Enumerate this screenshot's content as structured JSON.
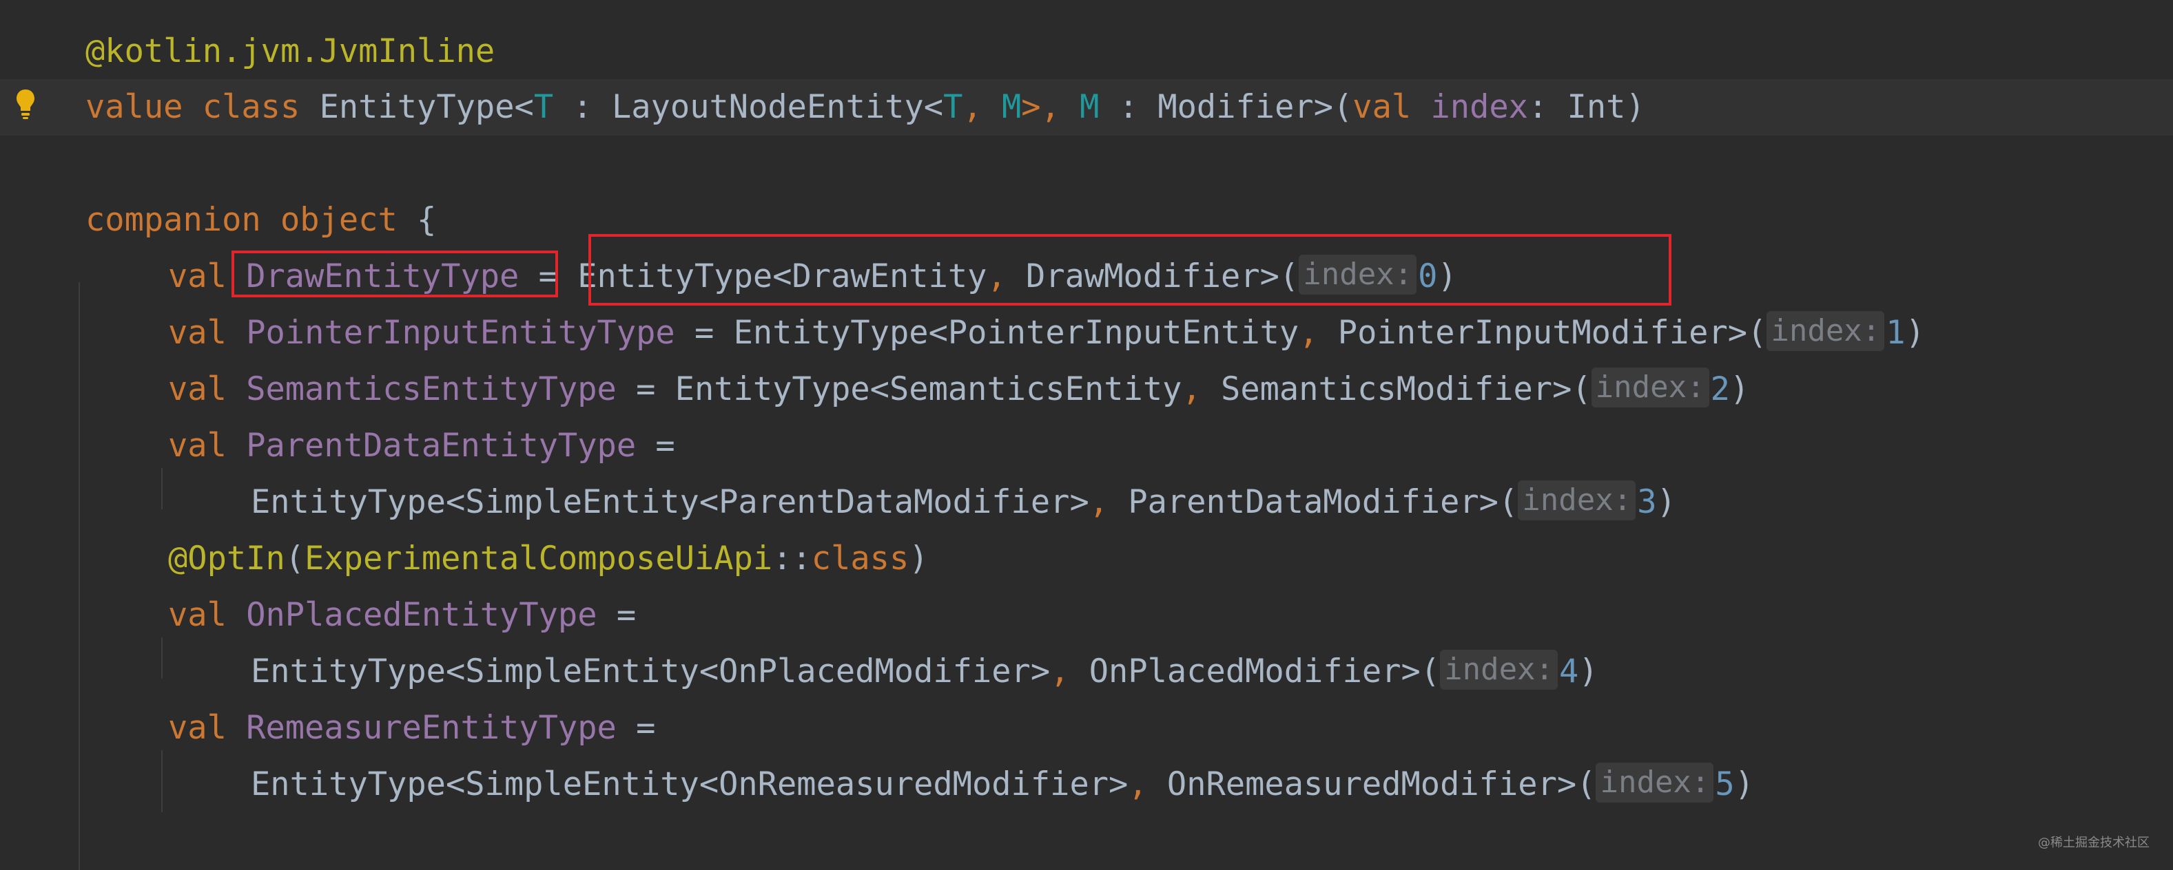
{
  "editor": {
    "lines": {
      "l1": {
        "annotation": "@kotlin.jvm.JvmInline"
      },
      "l2": {
        "kw_value": "value",
        "kw_class": "class",
        "class_name": "EntityType",
        "lt1": "<",
        "T1": "T",
        "colon1": " : ",
        "bound": "LayoutNodeEntity",
        "lt2": "<",
        "T2": "T",
        "comma1": ",",
        "M1": " M",
        "gt_comma": ">,",
        "M2": " M",
        "colon2": " : ",
        "modifier": "Modifier",
        "gt_paren": ">(",
        "kw_val": "val",
        "param": "index",
        "param_type": ": Int)"
      },
      "l4": {
        "kw_companion": "companion",
        "kw_object": "object",
        "brace": " {"
      },
      "l5": {
        "kw_val": "val",
        "name": "DrawEntityType",
        "eq": " = ",
        "call_a": "EntityType<DrawEntity",
        "comma": ",",
        "call_b": " DrawModifier>(",
        "hint": "index:",
        "arg": "0",
        "close": ")"
      },
      "l6": {
        "kw_val": "val",
        "name": "PointerInputEntityType",
        "eq": " = ",
        "call_a": "EntityType<PointerInputEntity",
        "comma": ",",
        "call_b": " PointerInputModifier>(",
        "hint": "index:",
        "arg": "1",
        "close": ")"
      },
      "l7": {
        "kw_val": "val",
        "name": "SemanticsEntityType",
        "eq": " = ",
        "call_a": "EntityType<SemanticsEntity",
        "comma": ",",
        "call_b": " SemanticsModifier>(",
        "hint": "index:",
        "arg": "2",
        "close": ")"
      },
      "l8": {
        "kw_val": "val",
        "name": "ParentDataEntityType",
        "eq": " ="
      },
      "l9": {
        "call_a": "EntityType<SimpleEntity<ParentDataModifier>",
        "comma": ",",
        "call_b": " ParentDataModifier>(",
        "hint": "index:",
        "arg": "3",
        "close": ")"
      },
      "l10": {
        "annotation": "@OptIn",
        "open": "(",
        "arg": "ExperimentalComposeUiApi",
        "sep": "::",
        "kw_class": "class",
        "close": ")"
      },
      "l11": {
        "kw_val": "val",
        "name": "OnPlacedEntityType",
        "eq": " ="
      },
      "l12": {
        "call_a": "EntityType<SimpleEntity<OnPlacedModifier>",
        "comma": ",",
        "call_b": " OnPlacedModifier>(",
        "hint": "index:",
        "arg": "4",
        "close": ")"
      },
      "l13": {
        "kw_val": "val",
        "name": "RemeasureEntityType",
        "eq": " ="
      },
      "l14": {
        "call_a": "EntityType<SimpleEntity<OnRemeasuredModifier>",
        "comma": ",",
        "call_b": " OnRemeasuredModifier>(",
        "hint": "index:",
        "arg": "5",
        "close": ")"
      }
    }
  },
  "watermark": "@稀土掘金技术社区",
  "colors": {
    "background": "#2b2b2b",
    "current_line": "#323232",
    "keyword": "#cc7832",
    "annotation": "#bbb529",
    "type_param": "#20999d",
    "property": "#9876aa",
    "number": "#6897bb",
    "default_text": "#a9b7c6",
    "highlight_box": "#e0262b",
    "bulb": "#e8b10e"
  },
  "icons": {
    "gutter": "lightbulb-icon"
  }
}
